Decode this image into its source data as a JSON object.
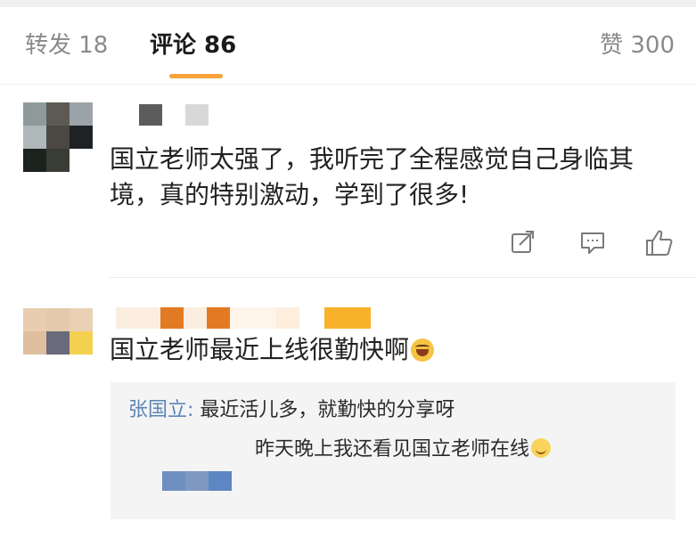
{
  "tabs": {
    "repost": "转发 18",
    "comment": "评论 86",
    "like": "赞 300"
  },
  "comments": [
    {
      "text_line1": "国立老师太强了，我听完了全程感觉自己身临其",
      "text_line2": "境，真的特别激动，学到了很多!",
      "actions": [
        "share-icon",
        "comment-icon",
        "like-icon"
      ]
    },
    {
      "text_line1": "国立老师最近上线很勤快啊",
      "emoji": "laughing-emoji",
      "reply": {
        "author": "张国立:",
        "line1": " 最近活儿多，就勤快的分享呀",
        "line2": "昨天晚上我还看见国立老师在线",
        "emoji": "smile-emoji"
      }
    }
  ],
  "colors": {
    "accent": "#f7a23a",
    "reply_author": "#5b84b8",
    "reply_bg": "#f4f4f4"
  }
}
